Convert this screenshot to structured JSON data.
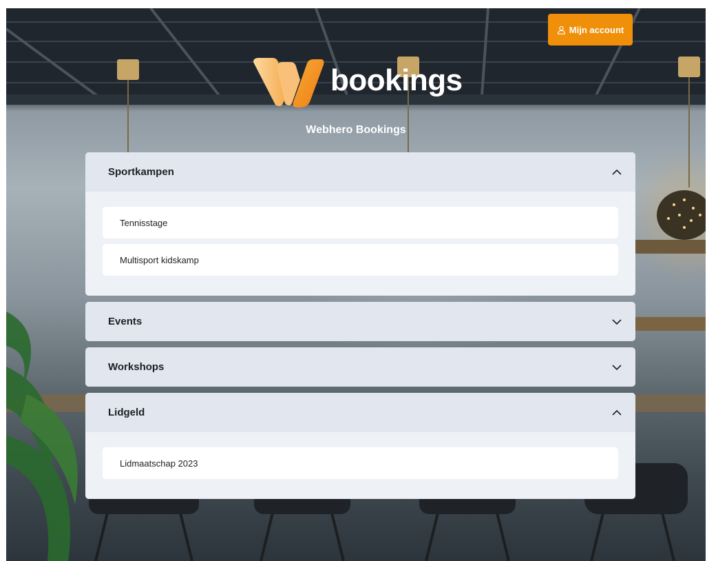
{
  "header": {
    "account_label": "Mijn account",
    "logo_text": "bookings",
    "site_title": "Webhero Bookings"
  },
  "colors": {
    "accent": "#f0900a",
    "panel": "#eef1f5",
    "panel_header": "#e2e7ef"
  },
  "sections": [
    {
      "title": "Sportkampen",
      "expanded": true,
      "items": [
        "Tennisstage",
        "Multisport kidskamp"
      ]
    },
    {
      "title": "Events",
      "expanded": false,
      "items": []
    },
    {
      "title": "Workshops",
      "expanded": false,
      "items": []
    },
    {
      "title": "Lidgeld",
      "expanded": true,
      "items": [
        "Lidmaatschap 2023"
      ]
    }
  ]
}
